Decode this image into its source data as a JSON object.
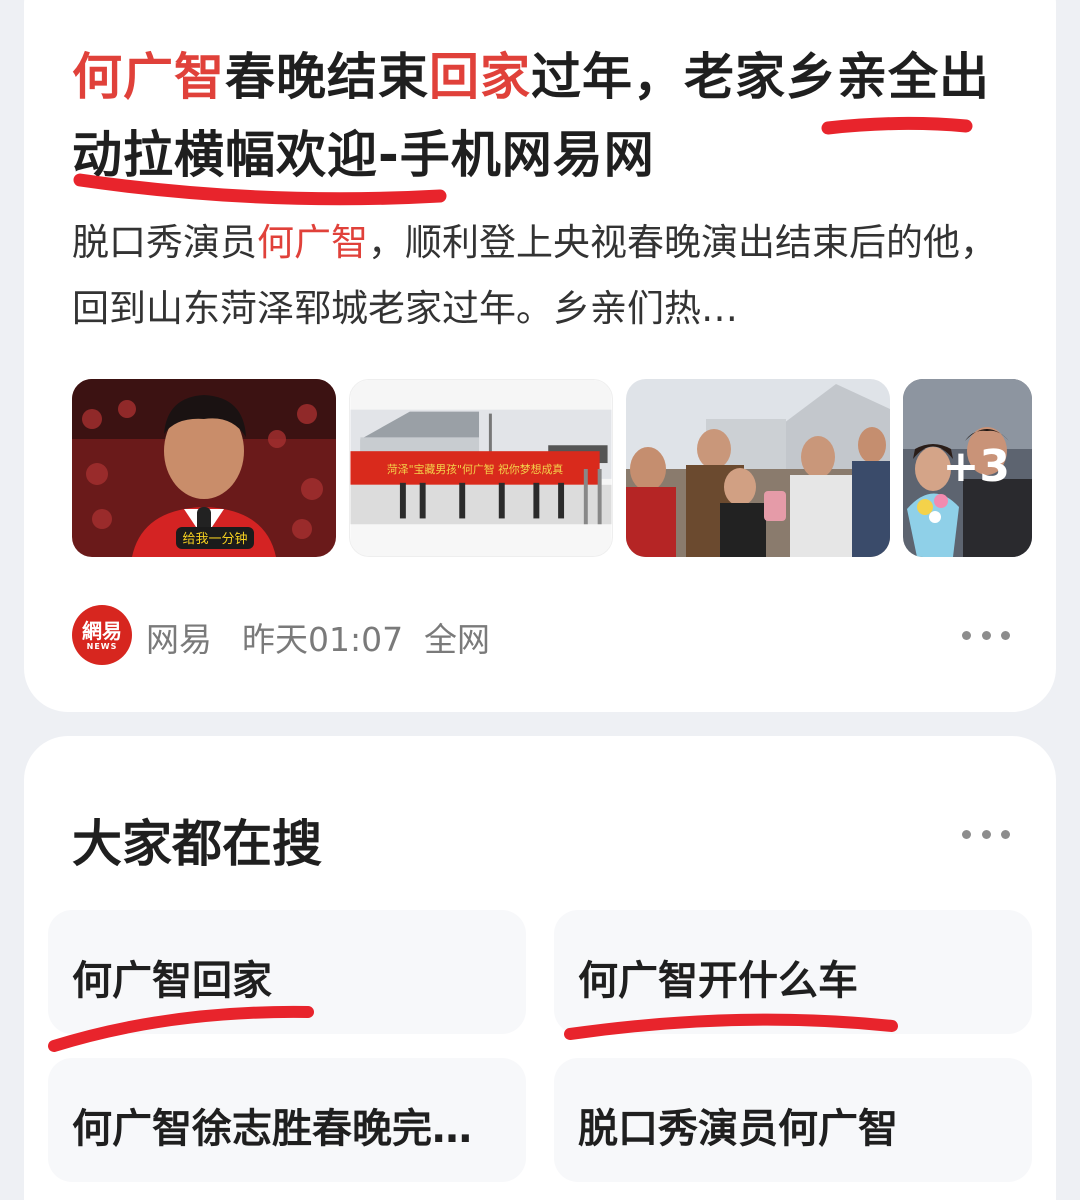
{
  "news": {
    "title_parts": [
      "何广智",
      "春晚结束",
      "回家",
      "过年，老家乡亲全出动拉横幅欢迎-手机网易网"
    ],
    "snippet_parts": [
      "脱口秀演员",
      "何广智",
      "，顺利登上央视春晚",
      "演出结束后的他，回到山东菏泽郓城老家过年。乡亲们热…"
    ],
    "images": [
      {
        "icon": "performer-photo",
        "caption": "给我一分钟"
      },
      {
        "icon": "banner-photo",
        "caption": "菏泽\"宝藏男孩\"何广智 祝你梦想成真"
      },
      {
        "icon": "crowd-photo"
      },
      {
        "icon": "bouquet-photo",
        "more": "+3"
      }
    ],
    "source": {
      "logo_text": "網易",
      "logo_sub": "NEWS",
      "name": "网易",
      "time": "昨天01:07",
      "scope": "全网"
    },
    "colors": {
      "highlight": "#e0413a",
      "annotation": "#e8242c"
    }
  },
  "search": {
    "title": "大家都在搜",
    "items": [
      "何广智回家",
      "何广智开什么车",
      "何广智徐志胜春晚完…",
      "脱口秀演员何广智"
    ]
  }
}
